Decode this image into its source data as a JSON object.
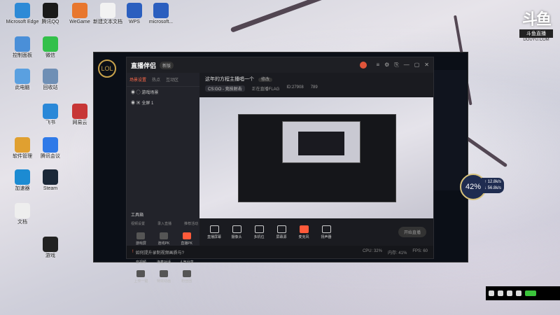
{
  "desktop_icons": [
    {
      "label": "Microsoft Edge",
      "color": "#2d8ad6"
    },
    {
      "label": "腾讯QQ",
      "color": "#1a1a1a"
    },
    {
      "label": "WeGame",
      "color": "#e8772e"
    },
    {
      "label": "新建文本文档",
      "color": "#f2f2f2"
    },
    {
      "label": "WPS",
      "color": "#2b5fbf"
    },
    {
      "label": "microsoft...",
      "color": "#2b5fbf"
    },
    {
      "label": "控制面板",
      "color": "#4a8fd8"
    },
    {
      "label": "微信",
      "color": "#33c04a"
    },
    {
      "label": "此电脑",
      "color": "#5aa0e0"
    },
    {
      "label": "回收站",
      "color": "#6f8fb5"
    },
    {
      "label": "网易云",
      "color": "#c73636"
    },
    {
      "label": "飞书",
      "color": "#2a88d8"
    },
    {
      "label": "软件管理",
      "color": "#e0a030"
    },
    {
      "label": "腾讯会议",
      "color": "#2f7ae8"
    },
    {
      "label": "加速器",
      "color": "#1c8bd2"
    },
    {
      "label": "Steam",
      "color": "#1b2838"
    },
    {
      "label": "文档",
      "color": "#eeeeee"
    },
    {
      "label": "游戏",
      "color": "#222"
    }
  ],
  "logo": {
    "big": "斗鱼",
    "box": "斗鱼直播",
    "sub": "DOUYU.COM"
  },
  "window": {
    "logo_text": "LOL"
  },
  "app": {
    "brand": "直播伴侣",
    "brand_pill": "新版",
    "top_icons": [
      "≡",
      "⚙",
      "⎘",
      "—",
      "▢",
      "✕"
    ],
    "tabs": [
      {
        "label": "场景设置",
        "active": true
      },
      {
        "label": "热点",
        "active": false
      },
      {
        "label": "互动区",
        "active": false
      }
    ],
    "scenes": [
      "◉  ◯  游戏场景",
      "◉  ▣  全屏 1"
    ],
    "tools_title": "工具箱",
    "tools_sub": [
      "视频设置",
      "录入直播",
      "推荐活动"
    ],
    "tools": [
      {
        "label": "游戏屏",
        "red": false
      },
      {
        "label": "连线PK",
        "red": false
      },
      {
        "label": "直播PK",
        "red": true
      },
      {
        "label": "音视频",
        "red": false
      },
      {
        "label": "连麦对话",
        "red": true
      },
      {
        "label": "人气分享",
        "red": false
      },
      {
        "label": "上传一键",
        "red": false
      },
      {
        "label": "特效动画",
        "red": false
      },
      {
        "label": "粉丝团",
        "red": false
      }
    ],
    "main_title": "这年的方程主播唱一个",
    "main_edit": "修改",
    "main_row": [
      "CS:GO - 竞技射击",
      "正在直播FLAG",
      "ID:27908",
      "789"
    ],
    "controls": [
      {
        "label": "直播屏幕",
        "red": false
      },
      {
        "label": "摄像头",
        "red": false
      },
      {
        "label": "多机位",
        "red": false
      },
      {
        "label": "屏幕源",
        "red": false
      },
      {
        "label": "麦克风",
        "red": true
      },
      {
        "label": "扬声器",
        "red": false
      }
    ],
    "start_label": "开始直播",
    "status_warn": "!",
    "status_text": "如何提升录制视频画质与?",
    "stats": [
      "CPU: 32%",
      "内存: 41%",
      "FPS: 60"
    ]
  },
  "fps_badge": {
    "value": "42%",
    "lines": [
      "↑ 12.8k/s",
      "↓ 56.8k/s"
    ]
  },
  "tray_icons": [
    "monitor-icon",
    "shield-icon",
    "settings-icon",
    "network-icon"
  ]
}
